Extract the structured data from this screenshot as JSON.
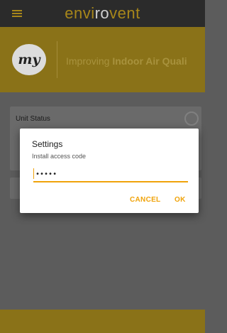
{
  "app": {
    "brand_prefix": "envi",
    "brand_accent": "ro",
    "brand_suffix": "vent",
    "menu_icon": "hamburger-menu-icon"
  },
  "hero": {
    "logo_text": "my",
    "tagline_prefix": "Improving ",
    "tagline_bold": "Indoor Air Quali"
  },
  "main": {
    "cards": [
      {
        "title": "Unit Status",
        "icon": "power-icon"
      }
    ]
  },
  "dialog": {
    "title": "Settings",
    "field_label": "Install access code",
    "field_value": "•••••",
    "cancel_label": "CANCEL",
    "ok_label": "OK"
  },
  "colors": {
    "accent": "#f0a30a",
    "brand_gold": "#a8871a",
    "topbar": "#2b2b2b",
    "hero_bg": "#8a7218",
    "scrim_bg": "#5c5c5c"
  }
}
